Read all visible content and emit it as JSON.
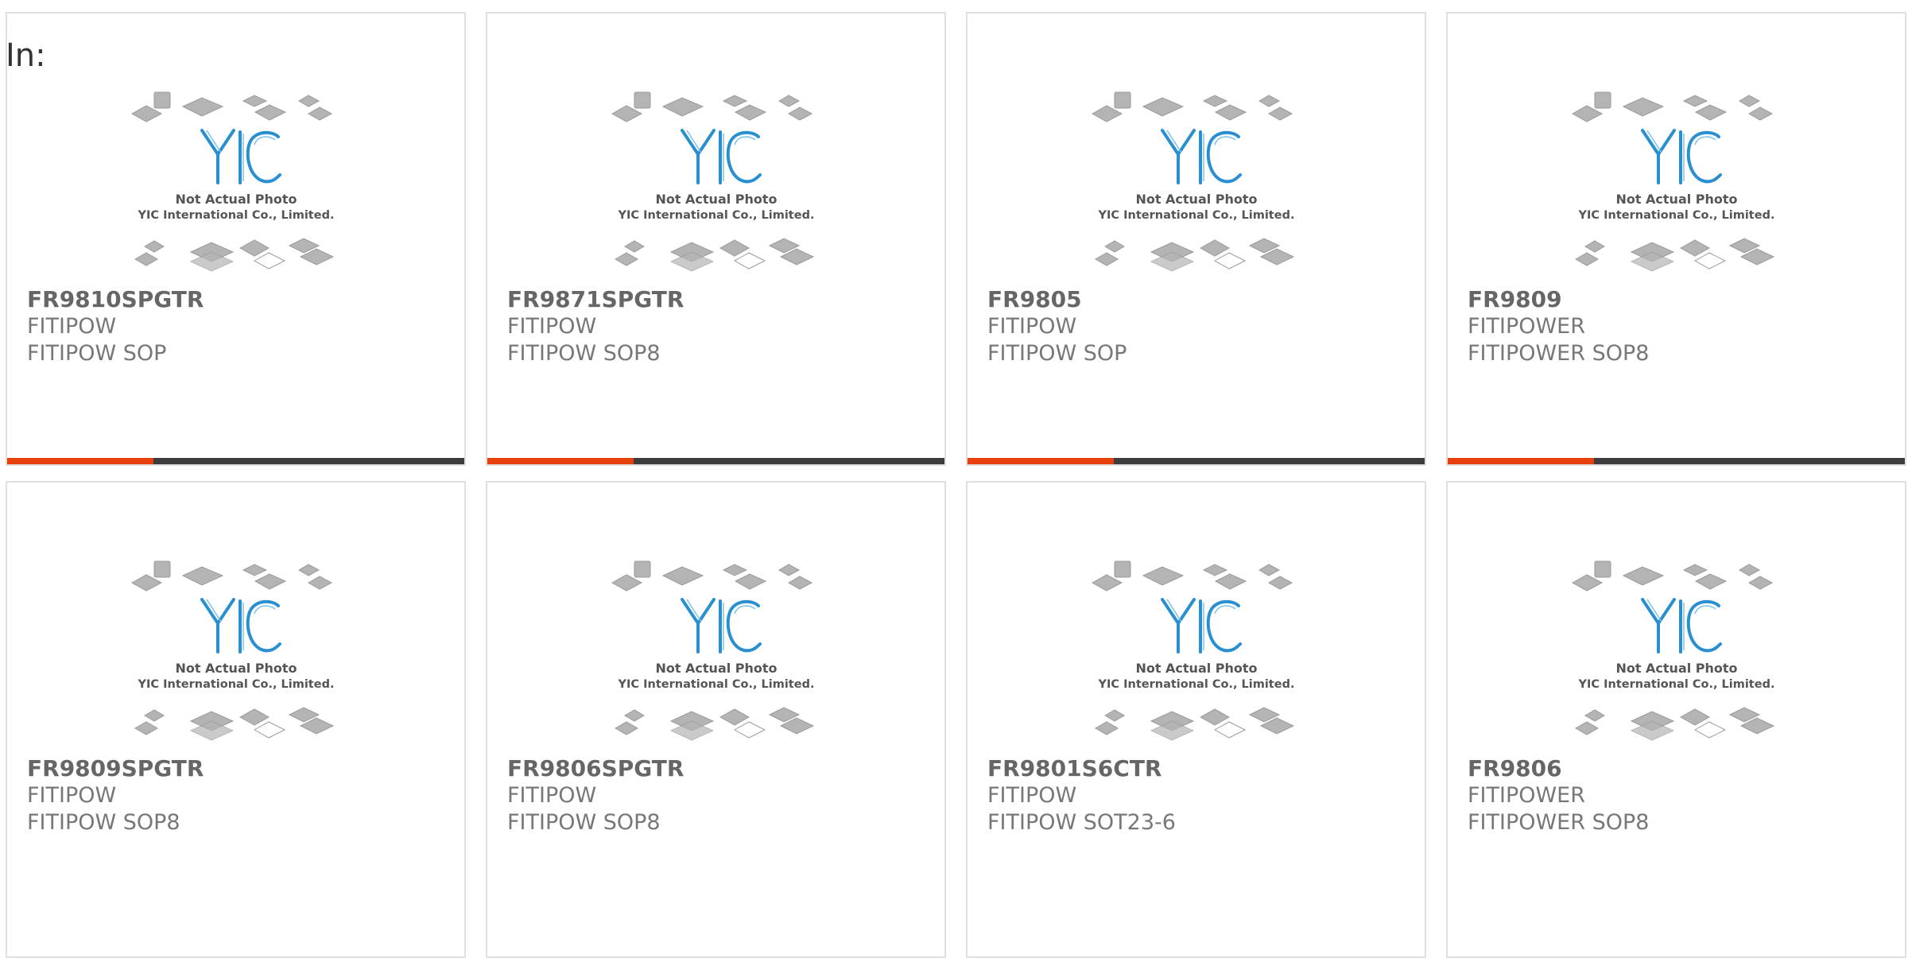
{
  "page": {
    "prefix_label": "In:"
  },
  "thumbnail": {
    "caption_line1": "Not Actual Photo",
    "caption_line2": "YIC International Co., Limited.",
    "logo_text": "YIC",
    "icon": "chip-packages-placeholder-icon"
  },
  "colors": {
    "accent": "#e8400c",
    "bar_track": "#3d3d3d",
    "logo_blue": "#2a8fd0",
    "text_gray": "#777777"
  },
  "products": [
    {
      "part": "FR9810SPGTR",
      "maker": "FITIPOW",
      "package": "FITIPOW SOP",
      "progress": 0.32
    },
    {
      "part": "FR9871SPGTR",
      "maker": "FITIPOW",
      "package": "FITIPOW SOP8",
      "progress": 0.32
    },
    {
      "part": "FR9805",
      "maker": "FITIPOW",
      "package": "FITIPOW SOP",
      "progress": 0.32
    },
    {
      "part": "FR9809",
      "maker": "FITIPOWER",
      "package": "FITIPOWER SOP8",
      "progress": 0.32
    },
    {
      "part": "FR9809SPGTR",
      "maker": "FITIPOW",
      "package": "FITIPOW SOP8",
      "progress": null
    },
    {
      "part": "FR9806SPGTR",
      "maker": "FITIPOW",
      "package": "FITIPOW SOP8",
      "progress": null
    },
    {
      "part": "FR9801S6CTR",
      "maker": "FITIPOW",
      "package": "FITIPOW SOT23-6",
      "progress": null
    },
    {
      "part": "FR9806",
      "maker": "FITIPOWER",
      "package": "FITIPOWER SOP8",
      "progress": null
    }
  ]
}
